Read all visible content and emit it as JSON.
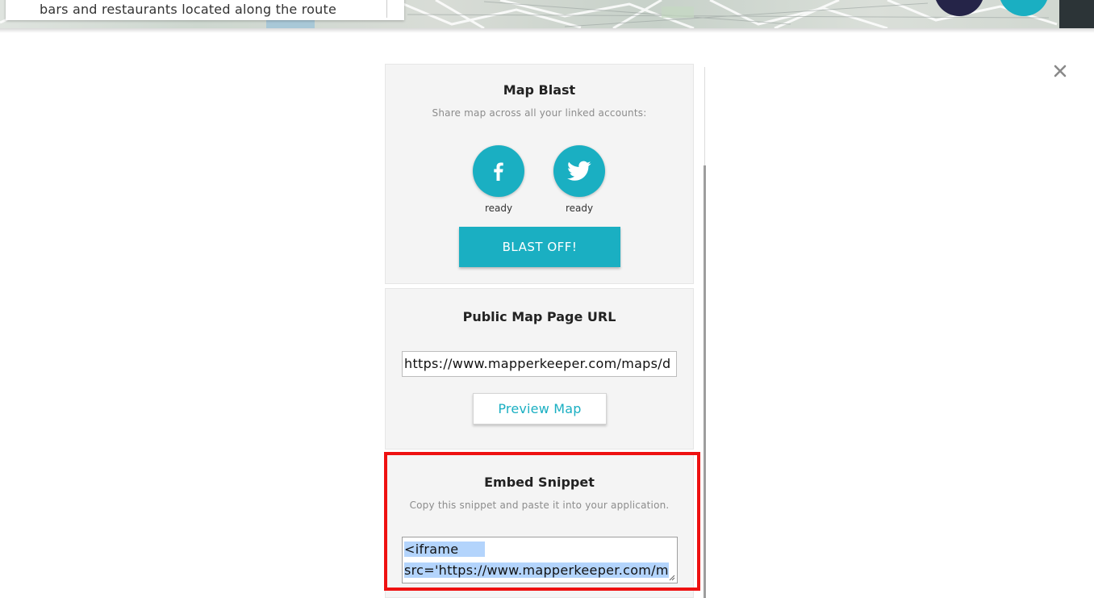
{
  "map_header": {
    "description_text": "bars and restaurants located along the route"
  },
  "close_icon": "close-icon",
  "map_blast": {
    "title": "Map Blast",
    "subtitle": "Share map across all your linked accounts:",
    "accounts": [
      {
        "name": "facebook",
        "icon": "facebook-icon",
        "status": "ready"
      },
      {
        "name": "twitter",
        "icon": "twitter-icon",
        "status": "ready"
      }
    ],
    "button_label": "BLAST OFF!"
  },
  "public_url": {
    "title": "Public Map Page URL",
    "url_value": "https://www.mapperkeeper.com/maps/d",
    "preview_label": "Preview Map"
  },
  "embed": {
    "title": "Embed Snippet",
    "subtitle": "Copy this snippet and paste it into your application.",
    "line1": "<iframe",
    "line2": "src='https://www.mapperkeeper.com/m"
  },
  "colors": {
    "accent": "#1aafc2",
    "card_bg": "#f4f4f4",
    "highlight": "#ee1111",
    "fab_dark": "#252448"
  }
}
